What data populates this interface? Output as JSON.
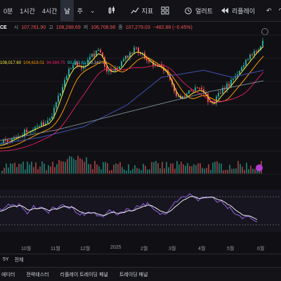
{
  "toolbar": {
    "items": [
      {
        "label": "0분"
      },
      {
        "label": "1시간"
      },
      {
        "label": "4시간"
      },
      {
        "label": "날"
      },
      {
        "label": "주"
      }
    ],
    "indicators_label": "지표",
    "alert_label": "얼러트",
    "replay_label": "리플레이"
  },
  "infobar": {
    "symbol": "CE",
    "open_label": "시",
    "open": "107,761.90",
    "high_label": "고",
    "high": "108,288.69",
    "low_label": "저",
    "low": "106,708.98",
    "close_label": "종",
    "close": "107,279.03",
    "change": "−482.88 (−0.45%)"
  },
  "ma_legend": [
    "108,017.60",
    "104,618.01",
    "94,984.75",
    "93,863.61",
    "89,342.39"
  ],
  "time_labels": [
    "10월",
    "11월",
    "12월",
    "2025",
    "2월",
    "3월",
    "4월",
    "5월",
    "6월"
  ],
  "bottombar": {
    "range_5y": "5Y",
    "range_all": "전체"
  },
  "panels": [
    "에디터",
    "전략테스터",
    "리플레이 트레이딩 패널",
    "트레이딩 패널"
  ],
  "colors": {
    "up": "#26a69a",
    "down": "#ef5350",
    "ma_fast": "#ffeb3b",
    "ma_mid": "#ff9800",
    "ma_slow": "#e91e63",
    "ma_blue": "#3f51b5",
    "rsi": "#ffffff",
    "rsi_band": "#7e57c2"
  }
}
